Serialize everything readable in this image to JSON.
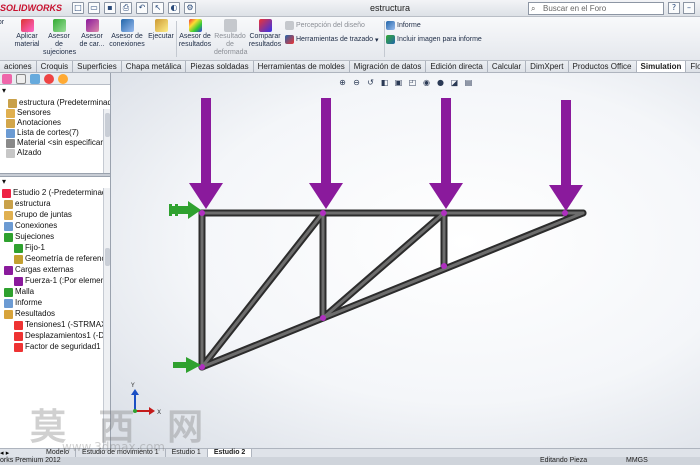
{
  "app": {
    "logo": "SOLIDWORKS",
    "document_title": "estructura",
    "search_placeholder": "Buscar en el Foro"
  },
  "ribbon": {
    "buttons": [
      {
        "label_1": "Aplicar",
        "label_2": "material",
        "icon": "apply-material-icon"
      },
      {
        "label_1": "Asesor",
        "label_2": "de sujeciones",
        "icon": "fixtures-advisor-icon"
      },
      {
        "label_1": "Asesor",
        "label_2": "de car...",
        "icon": "loads-advisor-icon"
      },
      {
        "label_1": "Asesor de",
        "label_2": "conexiones",
        "icon": "connections-advisor-icon"
      },
      {
        "label_1": "Ejecutar",
        "label_2": "",
        "icon": "run-icon"
      },
      {
        "label_1": "Asesor de",
        "label_2": "resultados",
        "icon": "results-advisor-icon"
      },
      {
        "label_1": "Resultado",
        "label_2": "de",
        "label_3": "deformada",
        "icon": "deformed-result-icon"
      },
      {
        "label_1": "Comparar",
        "label_2": "resultados",
        "icon": "compare-results-icon"
      }
    ],
    "small_items": [
      {
        "label": "Percepción del diseño",
        "icon": "design-insight-icon"
      },
      {
        "label": "Herramientas de trazado",
        "icon": "plot-tools-icon"
      },
      {
        "label": "Informe",
        "icon": "report-icon"
      },
      {
        "label": "Incluir imagen para informe",
        "icon": "include-image-icon"
      }
    ]
  },
  "tabs": [
    "aciones",
    "Croquis",
    "Superficies",
    "Chapa metálica",
    "Piezas soldadas",
    "Herramientas de moldes",
    "Migración de datos",
    "Edición directa",
    "Calcular",
    "DimXpert",
    "Productos Office",
    "Simulation",
    "Flow Simulation"
  ],
  "active_tab": "Simulation",
  "feature_tree": {
    "items": [
      {
        "label": "estructura  (Predeterminado<C",
        "icon": "part-icon"
      },
      {
        "label": "Sensores",
        "icon": "sensors-icon"
      },
      {
        "label": "Anotaciones",
        "icon": "annotations-icon"
      },
      {
        "label": "Lista de cortes(7)",
        "icon": "cut-list-icon"
      },
      {
        "label": "Material <sin especificar>",
        "icon": "material-icon"
      },
      {
        "label": "Alzado",
        "icon": "plane-icon"
      }
    ]
  },
  "study_tree": {
    "items": [
      {
        "label": "Estudio 2 (-Predeterminado<Com",
        "icon": "study-icon"
      },
      {
        "label": "estructura",
        "icon": "part-icon"
      },
      {
        "label": "Grupo de juntas",
        "icon": "joints-icon"
      },
      {
        "label": "Conexiones",
        "icon": "connections-icon"
      },
      {
        "label": "Sujeciones",
        "icon": "fixtures-icon"
      },
      {
        "label": "Fijo-1",
        "icon": "fixed-icon"
      },
      {
        "label": "Geometría de referencia-1",
        "icon": "reference-geometry-icon"
      },
      {
        "label": "Cargas externas",
        "icon": "external-loads-icon"
      },
      {
        "label": "Fuerza-1 (:Por elemento: -",
        "icon": "force-icon"
      },
      {
        "label": "Malla",
        "icon": "mesh-icon"
      },
      {
        "label": "Informe",
        "icon": "report-icon"
      },
      {
        "label": "Resultados",
        "icon": "results-icon"
      },
      {
        "label": "Tensiones1 (-STRMAX: Ter",
        "icon": "stress-icon"
      },
      {
        "label": "Desplazamientos1 (-Despl",
        "icon": "displacement-icon"
      },
      {
        "label": "Factor de seguridad1 (-FDS",
        "icon": "fos-icon"
      }
    ]
  },
  "bottom_tabs": [
    "Modelo",
    "Estudio de movimiento 1",
    "Estudio 1",
    "Estudio 2"
  ],
  "active_bottom_tab": "Estudio 2",
  "status": {
    "left": "orks Premium 2012",
    "middle": "Editando Pieza",
    "units": "MMGS"
  },
  "watermark": {
    "text": "莫 西 网",
    "url": "www.3dmax.com"
  },
  "colors": {
    "accent": "#7b1a8c",
    "force_arrow": "#8a1a9c",
    "fixture_arrow": "#2fa12f",
    "beam": "#3a3a3a"
  }
}
